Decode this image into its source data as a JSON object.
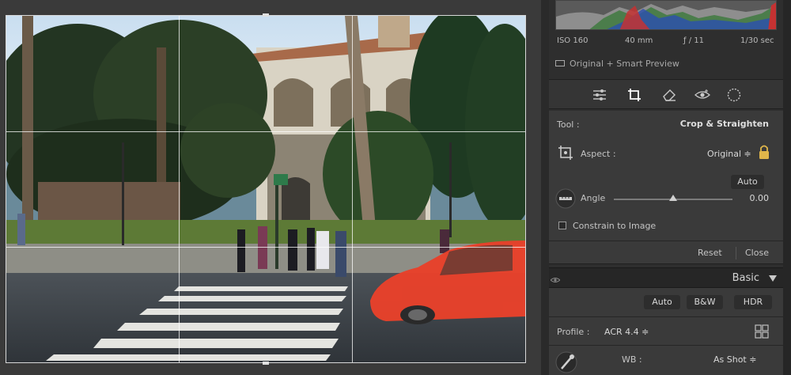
{
  "exif": {
    "iso": "ISO 160",
    "focal": "40 mm",
    "aperture": "ƒ / 11",
    "shutter": "1/30 sec"
  },
  "preview_status": "Original + Smart Preview",
  "tool_strip": {
    "icons": [
      "sliders-icon",
      "crop-icon",
      "eraser-icon",
      "redeye-icon",
      "mask-icon"
    ]
  },
  "crop": {
    "tool_label": "Tool :",
    "tool_name": "Crop & Straighten",
    "aspect_label": "Aspect :",
    "aspect_value": "Original ≑",
    "auto_label": "Auto",
    "angle_label": "Angle",
    "angle_value": "0.00",
    "angle_level": 0.5,
    "constrain_label": "Constrain to Image",
    "constrain_checked": false,
    "reset_label": "Reset",
    "close_label": "Close"
  },
  "basic": {
    "title": "Basic",
    "treatment_buttons": [
      "Auto",
      "B&W",
      "HDR"
    ],
    "profile_label": "Profile :",
    "profile_value": "ACR 4.4 ≑",
    "wb_label": "WB :",
    "wb_value": "As Shot ≑"
  },
  "colors": {
    "panel_bg": "#2e2e2e",
    "section_bg": "#3a3a3a",
    "car": "#e8412b",
    "lock": "#e0b64a"
  }
}
